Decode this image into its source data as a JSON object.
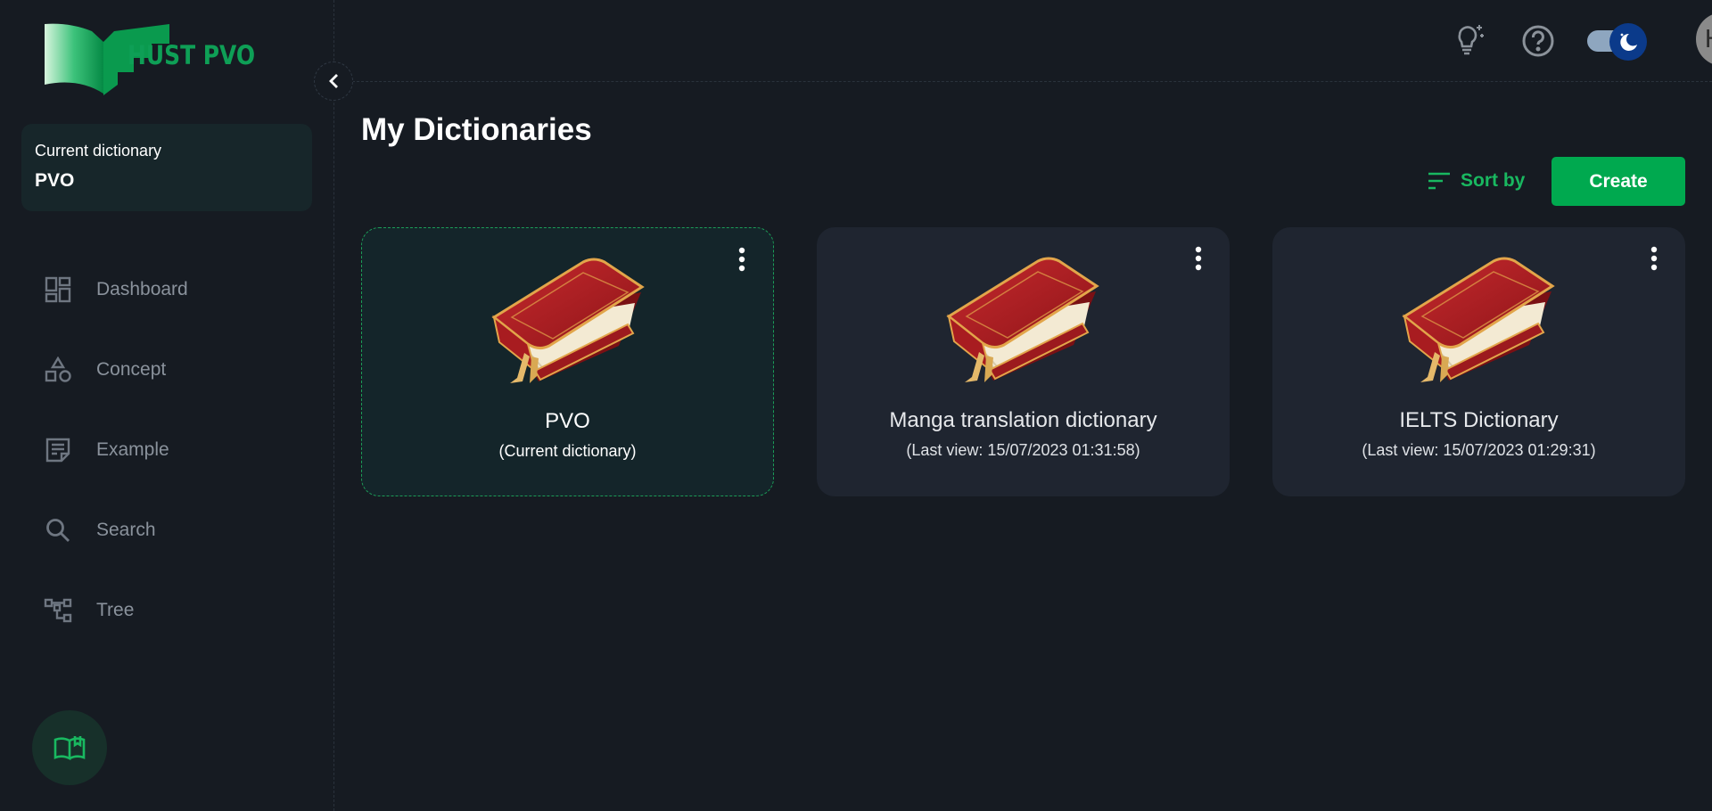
{
  "app": {
    "brand": "HUST PVO",
    "accent": "#00a94f"
  },
  "sidebar": {
    "current_dictionary_label": "Current dictionary",
    "current_dictionary_value": "PVO",
    "items": [
      {
        "label": "Dashboard",
        "icon": "dashboard-icon"
      },
      {
        "label": "Concept",
        "icon": "shapes-icon"
      },
      {
        "label": "Example",
        "icon": "note-icon"
      },
      {
        "label": "Search",
        "icon": "search-icon"
      },
      {
        "label": "Tree",
        "icon": "tree-icon"
      }
    ]
  },
  "header": {
    "avatar_initials": "HP",
    "theme": "dark"
  },
  "main": {
    "title": "My Dictionaries",
    "sort_label": "Sort by",
    "create_label": "Create",
    "cards": [
      {
        "name": "PVO",
        "subtitle": "(Current dictionary)",
        "current": true
      },
      {
        "name": "Manga translation dictionary",
        "subtitle": "(Last view: 15/07/2023 01:31:58)",
        "current": false
      },
      {
        "name": "IELTS Dictionary",
        "subtitle": "(Last view: 15/07/2023 01:29:31)",
        "current": false
      }
    ]
  }
}
